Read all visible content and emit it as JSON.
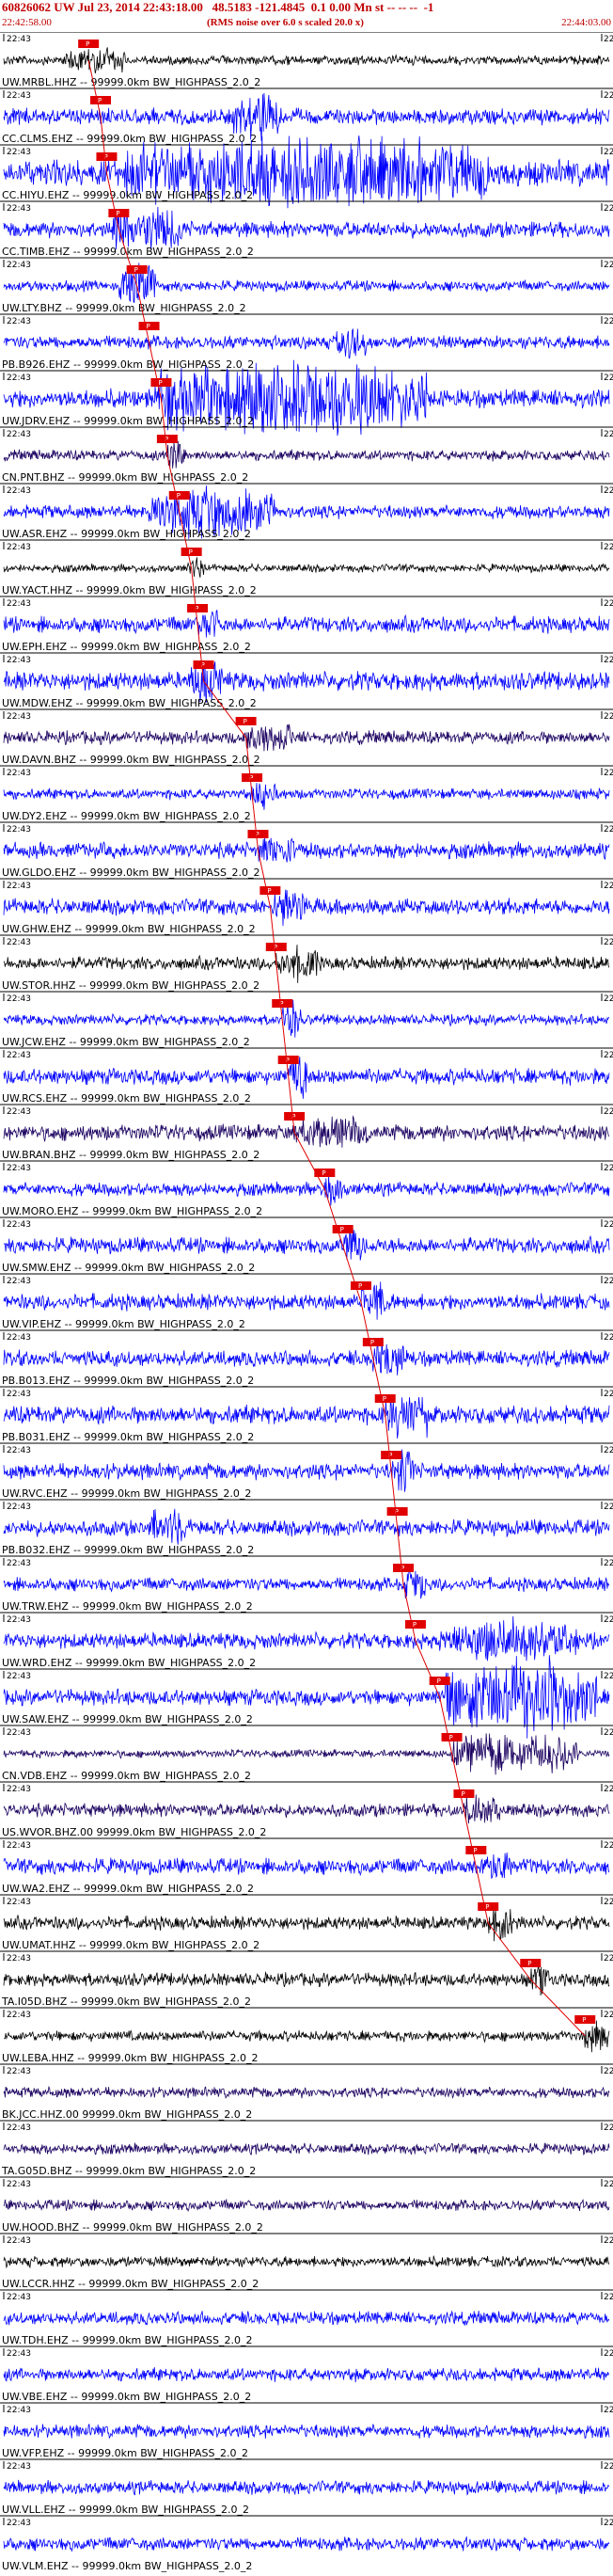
{
  "header": {
    "title": "60826062 UW Jul 23, 2014 22:43:18.00   48.5183 -121.4845  0.1 0.00 Mn st -- -- --  -1",
    "subtitle": "(RMS noise over 6.0 s scaled 20.0 x)",
    "time_start": "22:42:58.00",
    "time_end": "22:44:03.00"
  },
  "colors": {
    "header_red": "#c00000",
    "pick_red": "#e00000",
    "trace_blue": "#0000ff",
    "trace_black": "#000000",
    "trace_purple": "#1a0060"
  },
  "tick_labels": {
    "left": "22:43",
    "right": "22:4"
  },
  "pick_label": "P",
  "traces": [
    {
      "label": "UW.MRBL.HHZ -- 99999.0km BW_HIGHPASS_2.0_2",
      "color": "#000000",
      "pick": 0.14,
      "amp": 0.18,
      "burst": [
        0.1,
        0.2,
        0.4
      ]
    },
    {
      "label": "CC.CLMS.EHZ -- 99999.0km BW_HIGHPASS_2.0_2",
      "color": "#0000ff",
      "pick": 0.16,
      "amp": 0.3,
      "burst": [
        0.38,
        0.46,
        0.6
      ]
    },
    {
      "label": "CC.HIYU.EHZ -- 99999.0km BW_HIGHPASS_2.0_2",
      "color": "#0000ff",
      "pick": 0.17,
      "amp": 0.5,
      "burst": [
        0.2,
        0.8,
        1.0
      ]
    },
    {
      "label": "CC.TIMB.EHZ -- 99999.0km BW_HIGHPASS_2.0_2",
      "color": "#0000ff",
      "pick": 0.19,
      "amp": 0.3,
      "burst": [
        0.18,
        0.3,
        0.7
      ]
    },
    {
      "label": "UW.LTY.BHZ -- 99999.0km BW_HIGHPASS_2.0_2",
      "color": "#0000ff",
      "pick": 0.22,
      "amp": 0.2,
      "burst": [
        0.19,
        0.25,
        0.8
      ]
    },
    {
      "label": "PB.B926.EHZ -- 99999.0km BW_HIGHPASS_2.0_2",
      "color": "#0000ff",
      "pick": 0.24,
      "amp": 0.25,
      "burst": [
        0.55,
        0.6,
        0.5
      ]
    },
    {
      "label": "UW.JDRV.EHZ -- 99999.0km BW_HIGHPASS_2.0_2",
      "color": "#0000ff",
      "pick": 0.26,
      "amp": 0.35,
      "burst": [
        0.25,
        0.7,
        1.2
      ]
    },
    {
      "label": "CN.PNT.BHZ -- 99999.0km BW_HIGHPASS_2.0_2",
      "color": "#1a0060",
      "pick": 0.27,
      "amp": 0.2,
      "burst": [
        0.27,
        0.3,
        0.6
      ]
    },
    {
      "label": "UW.ASR.EHZ -- 99999.0km BW_HIGHPASS_2.0_2",
      "color": "#0000ff",
      "pick": 0.29,
      "amp": 0.25,
      "burst": [
        0.24,
        0.45,
        0.8
      ]
    },
    {
      "label": "UW.YACT.HHZ -- 99999.0km BW_HIGHPASS_2.0_2",
      "color": "#000000",
      "pick": 0.31,
      "amp": 0.15,
      "burst": [
        0.3,
        0.33,
        0.3
      ]
    },
    {
      "label": "UW.EPH.EHZ -- 99999.0km BW_HIGHPASS_2.0_2",
      "color": "#0000ff",
      "pick": 0.32,
      "amp": 0.3,
      "burst": [
        0.32,
        0.36,
        0.4
      ]
    },
    {
      "label": "UW.MDW.EHZ -- 99999.0km BW_HIGHPASS_2.0_2",
      "color": "#0000ff",
      "pick": 0.33,
      "amp": 0.35,
      "burst": [
        0.31,
        0.36,
        0.6
      ]
    },
    {
      "label": "UW.DAVN.BHZ -- 99999.0km BW_HIGHPASS_2.0_2",
      "color": "#1a0060",
      "pick": 0.4,
      "amp": 0.25,
      "burst": [
        0.4,
        0.48,
        0.4
      ]
    },
    {
      "label": "UW.DY2.EHZ -- 99999.0km BW_HIGHPASS_2.0_2",
      "color": "#0000ff",
      "pick": 0.41,
      "amp": 0.2,
      "burst": [
        0.41,
        0.45,
        0.4
      ]
    },
    {
      "label": "UW.GLDO.EHZ -- 99999.0km BW_HIGHPASS_2.0_2",
      "color": "#0000ff",
      "pick": 0.42,
      "amp": 0.3,
      "burst": [
        0.42,
        0.48,
        0.4
      ]
    },
    {
      "label": "UW.GHW.EHZ -- 99999.0km BW_HIGHPASS_2.0_2",
      "color": "#0000ff",
      "pick": 0.44,
      "amp": 0.3,
      "burst": [
        0.44,
        0.5,
        0.5
      ]
    },
    {
      "label": "UW.STOR.HHZ -- 99999.0km BW_HIGHPASS_2.0_2",
      "color": "#000000",
      "pick": 0.45,
      "amp": 0.25,
      "burst": [
        0.45,
        0.52,
        0.5
      ]
    },
    {
      "label": "UW.JCW.EHZ -- 99999.0km BW_HIGHPASS_2.0_2",
      "color": "#0000ff",
      "pick": 0.46,
      "amp": 0.2,
      "burst": [
        0.46,
        0.49,
        0.6
      ]
    },
    {
      "label": "UW.RCS.EHZ -- 99999.0km BW_HIGHPASS_2.0_2",
      "color": "#0000ff",
      "pick": 0.47,
      "amp": 0.3,
      "burst": [
        0.47,
        0.5,
        0.7
      ]
    },
    {
      "label": "UW.BRAN.BHZ -- 99999.0km BW_HIGHPASS_2.0_2",
      "color": "#1a0060",
      "pick": 0.48,
      "amp": 0.3,
      "burst": [
        0.48,
        0.6,
        0.4
      ]
    },
    {
      "label": "UW.MORO.EHZ -- 99999.0km BW_HIGHPASS_2.0_2",
      "color": "#0000ff",
      "pick": 0.53,
      "amp": 0.25,
      "burst": [
        0.53,
        0.56,
        0.4
      ]
    },
    {
      "label": "UW.SMW.EHZ -- 99999.0km BW_HIGHPASS_2.0_2",
      "color": "#0000ff",
      "pick": 0.56,
      "amp": 0.3,
      "burst": [
        0.56,
        0.6,
        0.5
      ]
    },
    {
      "label": "UW.VIP.EHZ -- 99999.0km BW_HIGHPASS_2.0_2",
      "color": "#0000ff",
      "pick": 0.59,
      "amp": 0.3,
      "burst": [
        0.59,
        0.63,
        0.6
      ]
    },
    {
      "label": "PB.B013.EHZ -- 99999.0km BW_HIGHPASS_2.0_2",
      "color": "#0000ff",
      "pick": 0.61,
      "amp": 0.3,
      "burst": [
        0.61,
        0.66,
        0.6
      ]
    },
    {
      "label": "PB.B031.EHZ -- 99999.0km BW_HIGHPASS_2.0_2",
      "color": "#0000ff",
      "pick": 0.63,
      "amp": 0.35,
      "burst": [
        0.63,
        0.7,
        0.7
      ]
    },
    {
      "label": "UW.RVC.EHZ -- 99999.0km BW_HIGHPASS_2.0_2",
      "color": "#0000ff",
      "pick": 0.64,
      "amp": 0.3,
      "burst": [
        0.64,
        0.68,
        0.6
      ]
    },
    {
      "label": "PB.B032.EHZ -- 99999.0km BW_HIGHPASS_2.0_2",
      "color": "#0000ff",
      "pick": 0.65,
      "amp": 0.3,
      "burst": [
        0.24,
        0.3,
        0.5
      ]
    },
    {
      "label": "UW.TRW.EHZ -- 99999.0km BW_HIGHPASS_2.0_2",
      "color": "#0000ff",
      "pick": 0.66,
      "amp": 0.25,
      "burst": [
        0.66,
        0.7,
        0.5
      ]
    },
    {
      "label": "UW.WRD.EHZ -- 99999.0km BW_HIGHPASS_2.0_2",
      "color": "#0000ff",
      "pick": 0.68,
      "amp": 0.3,
      "burst": [
        0.72,
        0.95,
        0.6
      ]
    },
    {
      "label": "UW.SAW.EHZ -- 99999.0km BW_HIGHPASS_2.0_2",
      "color": "#0000ff",
      "pick": 0.72,
      "amp": 0.3,
      "burst": [
        0.73,
        0.98,
        1.3
      ]
    },
    {
      "label": "CN.VDB.EHZ -- 99999.0km BW_HIGHPASS_2.0_2",
      "color": "#1a0060",
      "pick": 0.74,
      "amp": 0.15,
      "burst": [
        0.74,
        0.95,
        0.7
      ]
    },
    {
      "label": "US.WVOR.BHZ.00 99999.0km BW_HIGHPASS_2.0_2",
      "color": "#1a0060",
      "pick": 0.76,
      "amp": 0.25,
      "burst": [
        0.76,
        0.82,
        0.5
      ]
    },
    {
      "label": "UW.WA2.EHZ -- 99999.0km BW_HIGHPASS_2.0_2",
      "color": "#0000ff",
      "pick": 0.78,
      "amp": 0.3,
      "burst": [
        0.78,
        0.84,
        0.4
      ]
    },
    {
      "label": "UW.UMAT.HHZ -- 99999.0km BW_HIGHPASS_2.0_2",
      "color": "#000000",
      "pick": 0.8,
      "amp": 0.25,
      "burst": [
        0.8,
        0.85,
        0.5
      ]
    },
    {
      "label": "TA.I05D.BHZ -- 99999.0km BW_HIGHPASS_2.0_2",
      "color": "#000000",
      "pick": 0.87,
      "amp": 0.25,
      "burst": [
        0.87,
        0.9,
        0.4
      ]
    },
    {
      "label": "UW.LEBA.HHZ -- 99999.0km BW_HIGHPASS_2.0_2",
      "color": "#000000",
      "pick": 0.96,
      "amp": 0.2,
      "burst": [
        0.96,
        1.0,
        0.5
      ]
    },
    {
      "label": "BK.JCC.HHZ.00 99999.0km BW_HIGHPASS_2.0_2",
      "color": "#1a0060",
      "pick": null,
      "amp": 0.2,
      "burst": null
    },
    {
      "label": "TA.G05D.BHZ -- 99999.0km BW_HIGHPASS_2.0_2",
      "color": "#1a0060",
      "pick": null,
      "amp": 0.2,
      "burst": null
    },
    {
      "label": "UW.HOOD.BHZ -- 99999.0km BW_HIGHPASS_2.0_2",
      "color": "#1a0060",
      "pick": null,
      "amp": 0.2,
      "burst": null
    },
    {
      "label": "UW.LCCR.HHZ -- 99999.0km BW_HIGHPASS_2.0_2",
      "color": "#000000",
      "pick": null,
      "amp": 0.2,
      "burst": null
    },
    {
      "label": "UW.TDH.EHZ -- 99999.0km BW_HIGHPASS_2.0_2",
      "color": "#0000ff",
      "pick": null,
      "amp": 0.25,
      "burst": null
    },
    {
      "label": "UW.VBE.EHZ -- 99999.0km BW_HIGHPASS_2.0_2",
      "color": "#0000ff",
      "pick": null,
      "amp": 0.25,
      "burst": null
    },
    {
      "label": "UW.VFP.EHZ -- 99999.0km BW_HIGHPASS_2.0_2",
      "color": "#0000ff",
      "pick": null,
      "amp": 0.25,
      "burst": null
    },
    {
      "label": "UW.VLL.EHZ -- 99999.0km BW_HIGHPASS_2.0_2",
      "color": "#0000ff",
      "pick": null,
      "amp": 0.25,
      "burst": null
    },
    {
      "label": "UW.VLM.EHZ -- 99999.0km BW_HIGHPASS_2.0_2",
      "color": "#0000ff",
      "pick": null,
      "amp": 0.25,
      "burst": null
    }
  ]
}
